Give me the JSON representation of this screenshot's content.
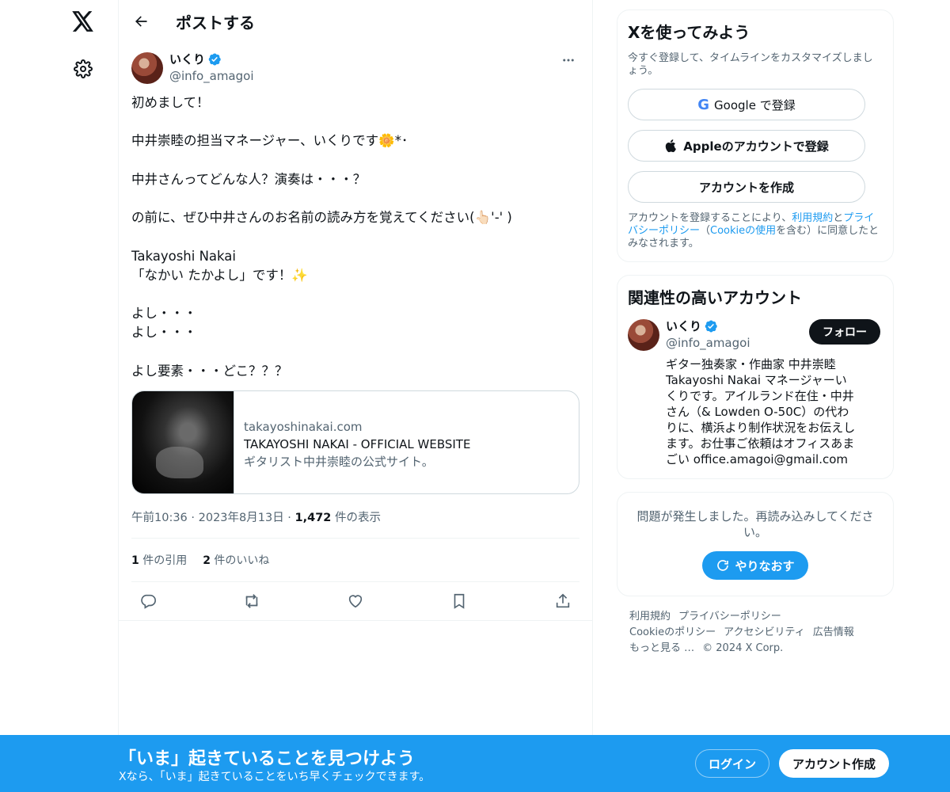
{
  "header": {
    "title": "ポストする"
  },
  "post": {
    "author_name": "いくり",
    "author_handle": "@info_amagoi",
    "lines": [
      "初めまして！",
      "",
      "中井崇睦の担当マネージャー、いくりです🌼*･",
      "",
      "中井さんってどんな人？演奏は・・・？",
      "",
      "の前に、ぜひ中井さんのお名前の読み方を覚えてください(👆🏻'-' )",
      "",
      "Takayoshi Nakai",
      "「なかい たかよし」です！✨",
      "",
      "よし・・・",
      "よし・・・",
      "",
      "よし要素・・・どこ？？？"
    ],
    "card": {
      "domain": "takayoshinakai.com",
      "title": "TAKAYOSHI NAKAI - OFFICIAL WEBSITE",
      "description": "ギタリスト中井崇睦の公式サイト。"
    },
    "time": "午前10:36",
    "date": "2023年8月13日",
    "views_count": "1,472",
    "views_label": "件の表示",
    "quotes_count": "1",
    "quotes_label": "件の引用",
    "likes_count": "2",
    "likes_label": "件のいいね"
  },
  "signup_box": {
    "title": "Xを使ってみよう",
    "subtitle": "今すぐ登録して、タイムラインをカスタマイズしましょう。",
    "google_label": "Google で登録",
    "apple_label": "Appleのアカウントで登録",
    "create_label": "アカウントを作成",
    "legal_pre": "アカウントを登録することにより、",
    "legal_terms": "利用規約",
    "legal_and": "と",
    "legal_privacy": "プライバシーポリシー",
    "legal_paren_open": "（",
    "legal_cookie": "Cookieの使用",
    "legal_post": "を含む）に同意したとみなされます。"
  },
  "related": {
    "title": "関連性の高いアカウント",
    "name": "いくり",
    "handle": "@info_amagoi",
    "follow_label": "フォロー",
    "bio": "ギター独奏家・作曲家 中井崇睦 Takayoshi Nakai マネージャーいくりです。アイルランド在住・中井さん（& Lowden O-50C）の代わりに、横浜より制作状況をお伝えします。お仕事ご依頼はオフィスあまごい office.amagoi@gmail.com"
  },
  "error_box": {
    "text": "問題が発生しました。再読み込みしてください。",
    "retry_label": "やりなおす"
  },
  "footer": {
    "terms": "利用規約",
    "privacy": "プライバシーポリシー",
    "cookie": "Cookieのポリシー",
    "accessibility": "アクセシビリティ",
    "ads": "広告情報",
    "more": "もっと見る …",
    "copyright": "© 2024 X Corp."
  },
  "banner": {
    "title": "「いま」起きていることを見つけよう",
    "subtitle": "Xなら、「いま」起きていることをいち早くチェックできます。",
    "login_label": "ログイン",
    "signup_label": "アカウント作成"
  },
  "colors": {
    "accent": "#1d9bf0",
    "text": "#0f1419",
    "muted": "#536471"
  }
}
